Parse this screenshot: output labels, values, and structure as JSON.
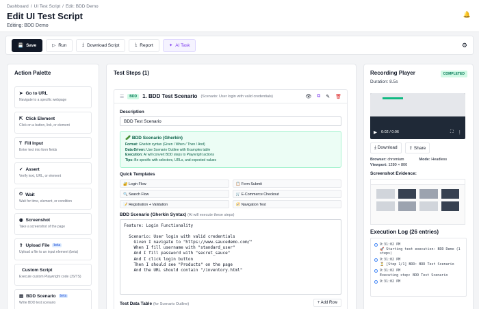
{
  "header": {
    "breadcrumb": [
      "Dashboard",
      "UI Test Script",
      "Edit: BDD Demo"
    ],
    "title": "Edit UI Test Script",
    "subtitle": "Editing: BDD Demo"
  },
  "toolbar": {
    "save": "Save",
    "run": "Run",
    "download": "Download Script",
    "report": "Report",
    "ai": "AI Task"
  },
  "palette": {
    "title": "Action Palette",
    "items": [
      {
        "name": "Go to URL",
        "desc": "Navigate to a specific webpage",
        "icon": "navigate-icon"
      },
      {
        "name": "Click Element",
        "desc": "Click on a button, link, or element",
        "icon": "click-icon"
      },
      {
        "name": "Fill Input",
        "desc": "Enter text into form fields",
        "icon": "text-icon"
      },
      {
        "name": "Assert",
        "desc": "Verify text, URL, or element",
        "icon": "check-icon"
      },
      {
        "name": "Wait",
        "desc": "Wait for time, element, or condition",
        "icon": "clock-icon"
      },
      {
        "name": "Screenshot",
        "desc": "Take a screenshot of the page",
        "icon": "camera-icon"
      },
      {
        "name": "Upload File",
        "desc": "Upload a file to an input element (beta)",
        "icon": "upload-icon",
        "badge": "beta"
      },
      {
        "name": "Custom Script",
        "desc": "Execute custom Playwright code (JS/TS)",
        "icon": "code-icon"
      },
      {
        "name": "BDD Scenario",
        "desc": "Write BDD test scenario",
        "icon": "doc-icon",
        "badge": "beta"
      }
    ]
  },
  "steps": {
    "title": "Test Steps (1)",
    "step": {
      "badge": "BDD",
      "name": "1. BDD Test Scenario",
      "sub": "(Scenario: User login with valid credentials)",
      "description_label": "Description",
      "description_value": "BDD Test Scenario",
      "gherkin_title": "🥒 BDD Scenario (Gherkin)",
      "gherkin_lines": [
        {
          "k": "Format:",
          "v": "Gherkin syntax (Given / When / Then / And)"
        },
        {
          "k": "Data-Driven:",
          "v": "Use Scenario Outline with Examples table"
        },
        {
          "k": "Execution:",
          "v": "AI will convert BDD steps to Playwright actions"
        },
        {
          "k": "Tips:",
          "v": "Be specific with selectors, URLs, and expected values"
        }
      ],
      "templates_label": "Quick Templates",
      "templates": [
        "🔐 Login Flow",
        "📋 Form Submit",
        "🔍 Search Flow",
        "🛒 E-Commerce Checkout",
        "📝 Registration + Validation",
        "🧭 Navigation Test"
      ],
      "syntax_label": "BDD Scenario (Gherkin Syntax)",
      "syntax_hint": "(AI will execute these steps)",
      "code": "Feature: Login Functionality\n\n  Scenario: User login with valid credentials\n    Given I navigate to \"https://www.saucedemo.com/\"\n    When I fill username with \"standard_user\"\n    And I fill password with \"secret_sauce\"\n    And I click login button\n    Then I should see \"Products\" on the page\n    And the URL should contain \"/inventory.html\"",
      "table_label": "Test Data Table",
      "table_hint": "(for Scenario Outline)",
      "add_row": "+ Add Row"
    }
  },
  "recording": {
    "title": "Recording Player",
    "status": "COMPLETED",
    "duration": "Duration: 8.5s",
    "video_time": "0:02 / 0:06",
    "download": "Download",
    "share": "Share",
    "browser_label": "Browser:",
    "browser": "chromium",
    "mode_label": "Mode:",
    "mode": "Headless",
    "viewport_label": "Viewport:",
    "viewport": "1280 × 800",
    "evidence": "Screenshot Evidence:",
    "log_title": "Execution Log (26 entries)",
    "logs": [
      {
        "time": "9:31:02 PM",
        "msg": "🚀 Starting test execution: BDD Demo (1 steps)"
      },
      {
        "time": "9:31:02 PM",
        "msg": "⏳ [Step 1/1] BDD: BDD Test Scenario"
      },
      {
        "time": "9:31:02 PM",
        "msg": "Executing step: BDD Test Scenario"
      },
      {
        "time": "9:31:02 PM",
        "msg": ""
      }
    ]
  }
}
